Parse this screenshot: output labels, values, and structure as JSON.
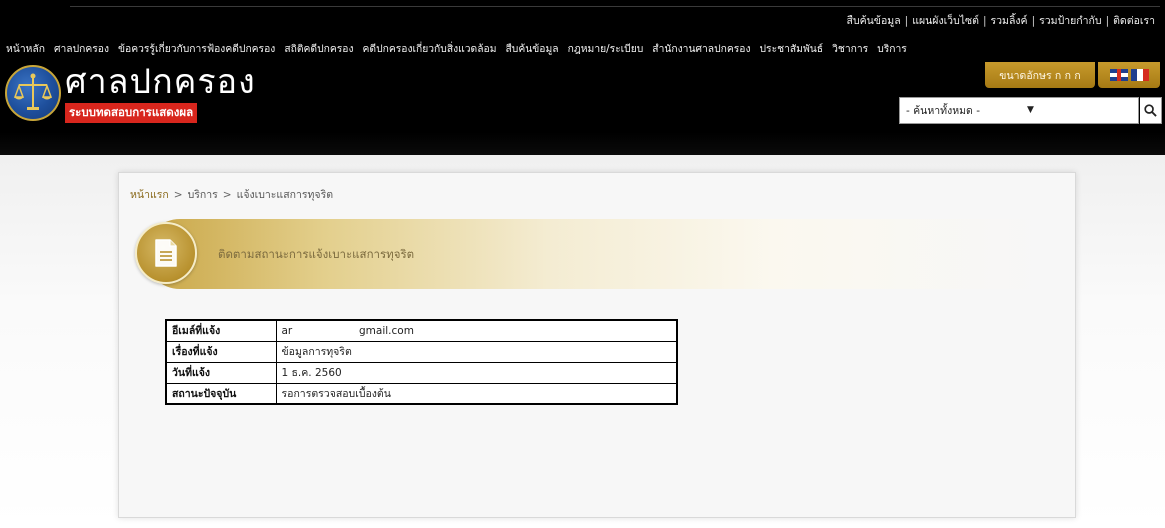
{
  "top_links": [
    "สืบค้นข้อมูล",
    "แผนผังเว็บไซต์",
    "รวมลิ้งค์",
    "รวมป้ายกำกับ",
    "ติดต่อเรา"
  ],
  "top_links_separator": "|",
  "main_nav": [
    "หน้าหลัก",
    "ศาลปกครอง",
    "ข้อควรรู้เกี่ยวกับการฟ้องคดีปกครอง",
    "สถิติคดีปกครอง",
    "คดีปกครองเกี่ยวกับสิ่งแวดล้อม",
    "สืบค้นข้อมูล",
    "กฎหมาย/ระเบียบ",
    "สำนักงานศาลปกครอง",
    "ประชาสัมพันธ์",
    "วิชาการ",
    "บริการ"
  ],
  "logo": {
    "title": "ศาลปกครอง",
    "subtitle": "ระบบทดสอบการแสดงผล"
  },
  "font_size_label": "ขนาดอักษร ก ก ก",
  "search": {
    "select_value": "- ค้นหาทั้งหมด -",
    "icon": "search-icon"
  },
  "breadcrumb": {
    "items": [
      "หน้าแรก",
      "บริการ",
      "แจ้งเบาะแสการทุจริต"
    ],
    "separator": ">"
  },
  "banner": {
    "title": "ติดตามสถานะการแจ้งเบาะแสการทุจริต",
    "icon": "document-icon"
  },
  "info_table": [
    {
      "label": "อีเมล์ที่แจ้ง",
      "value": "ar                    gmail.com"
    },
    {
      "label": "เรื่องที่แจ้ง",
      "value": "ข้อมูลการทุจริต"
    },
    {
      "label": "วันที่แจ้ง",
      "value": "1 ธ.ค. 2560"
    },
    {
      "label": "สถานะปัจจุบัน",
      "value": "รอการตรวจสอบเบื้องต้น"
    }
  ],
  "colors": {
    "header_bg": "#000000",
    "accent_gold": "#c9a646",
    "subtitle_red": "#d8261d"
  }
}
